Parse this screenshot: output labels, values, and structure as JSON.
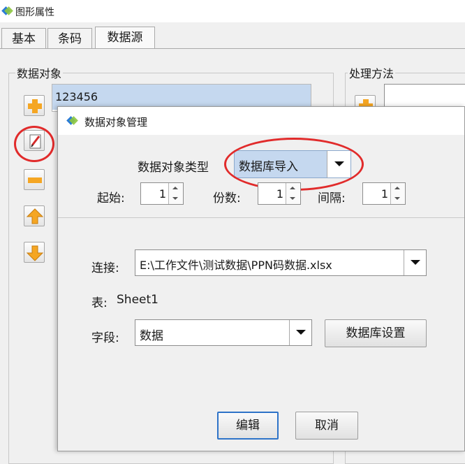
{
  "outer_window": {
    "title": "图形属性"
  },
  "tabs": [
    {
      "label": "基本"
    },
    {
      "label": "条码"
    },
    {
      "label": "数据源"
    }
  ],
  "data_objects": {
    "group_label": "数据对象",
    "list_items": [
      "123456"
    ]
  },
  "processing": {
    "group_label": "处理方法"
  },
  "sidebar_buttons": [
    {
      "icon": "add-icon"
    },
    {
      "icon": "edit-icon"
    },
    {
      "icon": "remove-icon"
    },
    {
      "icon": "move-up-icon"
    },
    {
      "icon": "move-down-icon"
    }
  ],
  "dialog": {
    "title": "数据对象管理",
    "type_label": "数据对象类型",
    "type_value": "数据库导入",
    "start_label": "起始:",
    "start_value": "1",
    "copies_label": "份数:",
    "copies_value": "1",
    "interval_label": "间隔:",
    "interval_value": "1",
    "connection_label": "连接:",
    "connection_value": "E:\\工作文件\\测试数据\\PPN码数据.xlsx",
    "table_label": "表:",
    "table_value": "Sheet1",
    "field_label": "字段:",
    "field_value": "数据",
    "db_settings_button": "数据库设置",
    "edit_button": "编辑",
    "cancel_button": "取消"
  },
  "colors": {
    "annotation_red": "#e12b2b",
    "selection_blue": "#c5d8ef",
    "focus_blue": "#2e73c8",
    "arrow_orange": "#f5a623"
  }
}
